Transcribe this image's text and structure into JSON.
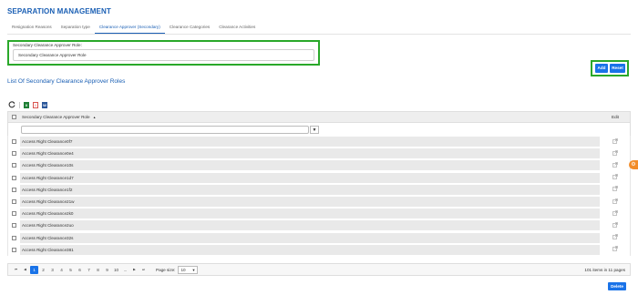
{
  "page": {
    "title": "SEPARATION MANAGEMENT"
  },
  "tabs": [
    {
      "label": "Resignation Reasons"
    },
    {
      "label": "Separation type"
    },
    {
      "label": "Clearance Approver (Secondary)"
    },
    {
      "label": "Clearance Categories"
    },
    {
      "label": "Clearance Activities"
    }
  ],
  "form": {
    "label": "Secondary Clearance Approver Role:",
    "value": "Secondary Clearance Approver Role",
    "add_label": "Add",
    "reset_label": "Reset"
  },
  "list": {
    "title": "List Of Secondary Clearance Approver Roles",
    "columns": {
      "name": "Secondary Clearance Approver Role",
      "sort_icon": "▲",
      "edit": "Edit"
    },
    "rows": [
      "Access Right Clearance0f7",
      "Access Right Clearance0e4",
      "Access Right Clearance10s",
      "Access Right Clearance1d7",
      "Access Right Clearance1f2",
      "Access Right Clearance21w",
      "Access Right Clearance2k0",
      "Access Right Clearance2uo",
      "Access Right Clearance32s",
      "Access Right Clearance381"
    ]
  },
  "pager": {
    "first": "⏮",
    "prev": "◀",
    "next": "▶",
    "last": "⏭",
    "pages": [
      "1",
      "2",
      "3",
      "4",
      "5",
      "6",
      "7",
      "8",
      "9",
      "10",
      "..."
    ],
    "current_page": 1,
    "page_size_label": "Page size:",
    "page_size": "10",
    "info": "101 items in 11 pages"
  },
  "actions": {
    "delete_label": "Delete"
  },
  "colors": {
    "accent": "#1a73e8",
    "title": "#1a5fb4",
    "highlight": "#2aa82a"
  }
}
